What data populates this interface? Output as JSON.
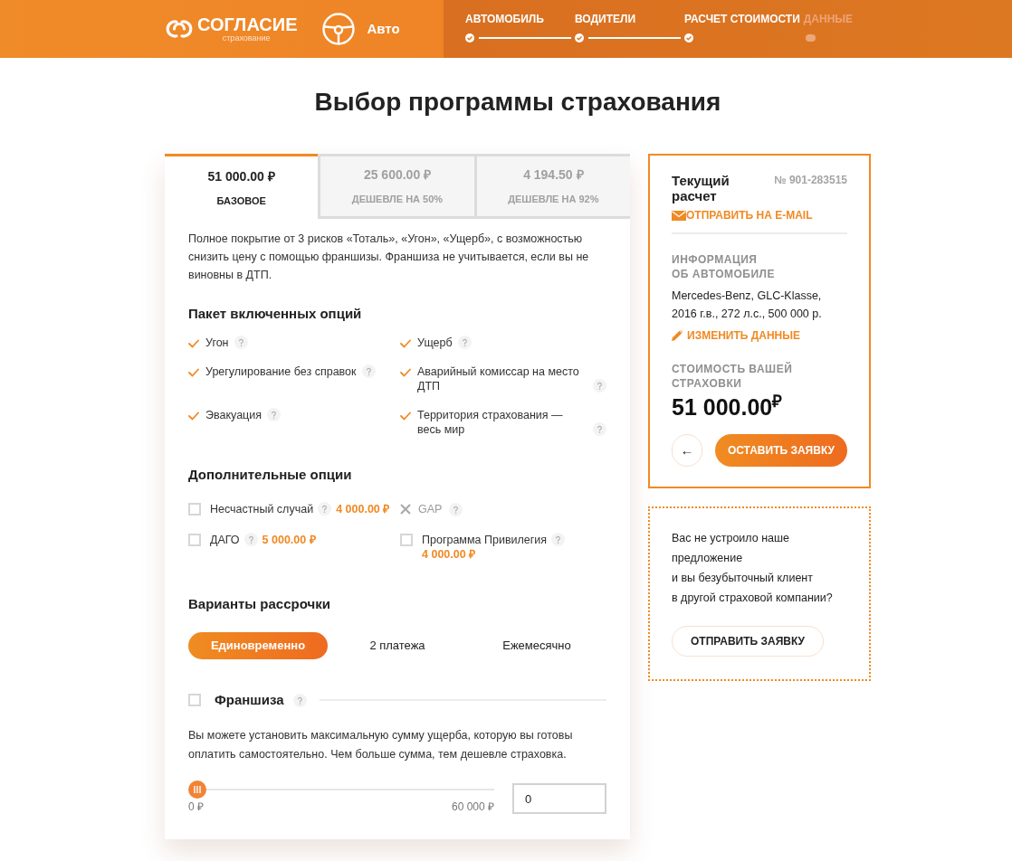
{
  "header": {
    "logo": {
      "name": "СОГЛАСИЕ",
      "tagline": "страхование"
    },
    "product": "Авто",
    "steps": [
      {
        "label": "АВТОМОБИЛЬ",
        "done": true
      },
      {
        "label": "ВОДИТЕЛИ",
        "done": true
      },
      {
        "label": "РАСЧЕТ СТОИМОСТИ",
        "done": true
      },
      {
        "label": "ДАННЫЕ",
        "done": false
      }
    ]
  },
  "title": "Выбор программы страхования",
  "program": {
    "tabs": [
      {
        "price": "51 000.00 ₽",
        "label": "БАЗОВОЕ",
        "selected": true
      },
      {
        "price": "25 600.00 ₽",
        "label": "ДЕШЕВЛЕ НА 50%",
        "selected": false
      },
      {
        "price": "4 194.50 ₽",
        "label": "ДЕШЕВЛЕ НА 92%",
        "selected": false
      }
    ],
    "description": "Полное покрытие от 3 рисков «Тоталь», «Угон», «Ущерб», с возможностью снизить цену с помощью франшизы. Франшиза не учитывается, если вы не виновны в ДТП.",
    "included": {
      "heading": "Пакет включенных опций",
      "items": [
        "Угон",
        "Ущерб",
        "Урегулирование без справок",
        "Аварийный комиссар на место ДТП",
        "Эвакуация",
        "Территория страхования — весь мир"
      ]
    },
    "additional": {
      "heading": "Дополнительные опции",
      "items": [
        {
          "kind": "checkbox",
          "label": "Несчастный случай",
          "checked": false,
          "price": "4 000.00 ₽"
        },
        {
          "kind": "unavailable",
          "label": "GAP"
        },
        {
          "kind": "checkbox",
          "label": "ДАГО",
          "checked": false,
          "price": "5 000.00 ₽"
        },
        {
          "kind": "checkbox",
          "label": "Программа Привилегия",
          "checked": false,
          "price": "4 000.00 ₽"
        }
      ]
    },
    "installments": {
      "heading": "Варианты рассрочки",
      "options": [
        {
          "label": "Единовременно",
          "selected": true
        },
        {
          "label": "2 платежа",
          "selected": false
        },
        {
          "label": "Ежемесячно",
          "selected": false
        }
      ]
    },
    "franchise": {
      "title": "Франшиза",
      "checked": false,
      "description": "Вы можете установить максимальную сумму ущерба, которую вы готовы оплатить самостоятельно. Чем больше сумма, тем дешевле страховка.",
      "slider": {
        "level": 0,
        "min_label": "0 ₽",
        "max_label": "60 000 ₽"
      },
      "value": "0"
    }
  },
  "summary": {
    "title": "Текущий\nрасчет",
    "number": "№ 901-283515",
    "email_link": "ОТПРАВИТЬ НА E-MAIL",
    "car_heading": "ИНФОРМАЦИЯ\nОБ АВТОМОБИЛЕ",
    "car_info": "Mercedes-Benz, GLC-Klasse, 2016 г.в., 272 л.с., 500 000 р.",
    "edit_link": "ИЗМЕНИТЬ ДАННЫЕ",
    "cost_heading": "СТОИМОСТЬ ВАШЕЙ\nСТРАХОВКИ",
    "cost": "51 000.00$^{₽}$",
    "back_button": "←",
    "submit_button": "ОСТАВИТЬ ЗАЯВКУ"
  },
  "offer": {
    "text": "Вас не устроило наше предложение\nи вы безубыточный клиент\nв другой страховой компании?",
    "button": "ОТПРАВИТЬ ЗАЯВКУ"
  }
}
